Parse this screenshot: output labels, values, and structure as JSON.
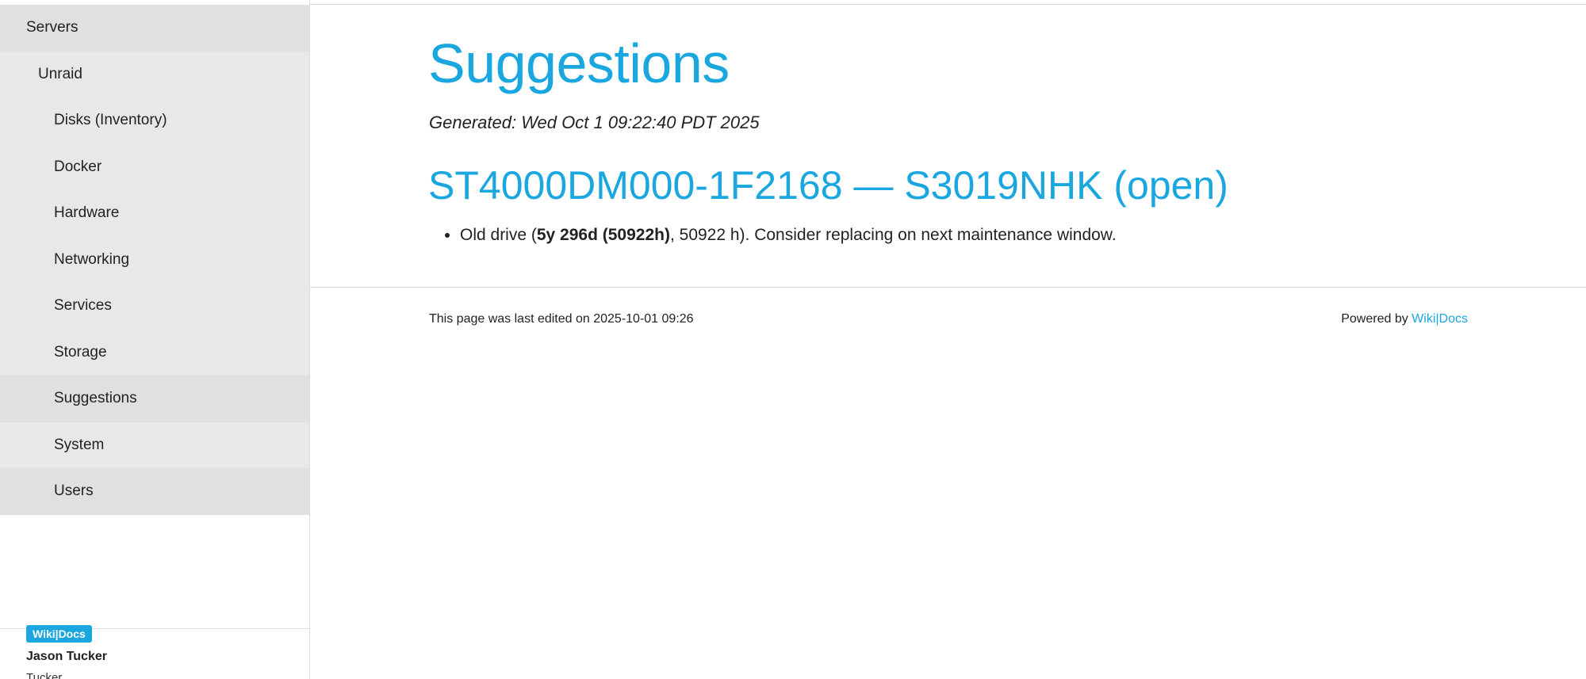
{
  "sidebar": {
    "items": [
      {
        "label": "Servers"
      },
      {
        "label": "Unraid"
      },
      {
        "label": "Disks (Inventory)"
      },
      {
        "label": "Docker"
      },
      {
        "label": "Hardware"
      },
      {
        "label": "Networking"
      },
      {
        "label": "Services"
      },
      {
        "label": "Storage"
      },
      {
        "label": "Suggestions"
      },
      {
        "label": "System"
      },
      {
        "label": "Users"
      }
    ],
    "active_item": "Suggestions",
    "footer": {
      "brand": "Wiki|Docs",
      "user_name": "Jason Tucker",
      "user_sub": "Tucker"
    }
  },
  "main": {
    "title": "Suggestions",
    "generated": "Generated: Wed Oct 1 09:22:40 PDT 2025",
    "sections": [
      {
        "heading": "ST4000DM000-1F2168 — S3019NHK (open)",
        "bullets": [
          {
            "prefix": "Old drive (",
            "bold": "5y 296d (50922h)",
            "suffix": ", 50922 h). Consider replacing on next maintenance window."
          }
        ]
      }
    ]
  },
  "footer": {
    "last_edited": "This page was last edited on 2025-10-01 09:26",
    "powered_prefix": "Powered by",
    "powered_link": "Wiki|Docs"
  },
  "colors": {
    "accent": "#1aa7e0",
    "sidebar_bg": "#e8e8e8",
    "sidebar_active_bg": "#e0e0e0"
  }
}
